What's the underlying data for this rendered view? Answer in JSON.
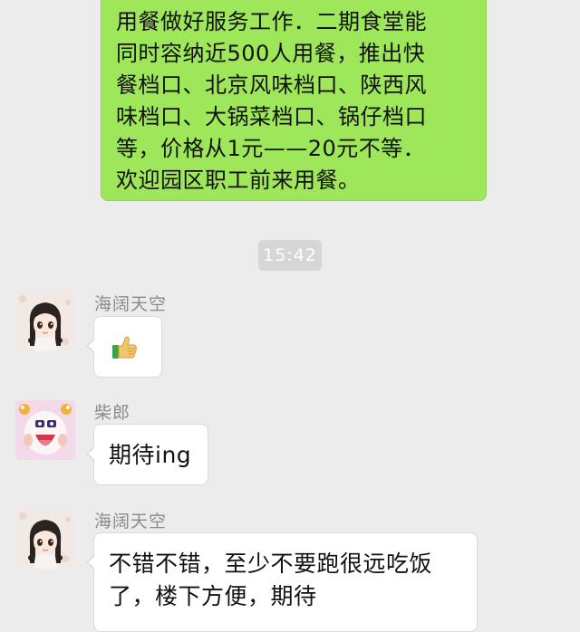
{
  "outgoing_message": {
    "lines": [
      "用餐做好服务工作．二期食堂能",
      "同时容纳近500人用餐，推出快",
      "餐档口、北京风味档口、陕西风",
      "味档口、大锅菜档口、锅仔档口",
      "等，价格从1元——20元不等．",
      "欢迎园区职工前来用餐。"
    ]
  },
  "timestamp": "15:42",
  "messages": [
    {
      "sender": "海阔天空",
      "avatar": "girl-avatar-icon",
      "content_icon": "thumbs-up-emoji-icon"
    },
    {
      "sender": "柴郎",
      "avatar": "cartoon-face-avatar-icon",
      "text": "期待ing"
    },
    {
      "sender": "海阔天空",
      "avatar": "girl-avatar-icon",
      "lines": [
        "不错不错，至少不要跑很远吃饭",
        "了，楼下方便，期待"
      ]
    }
  ],
  "colors": {
    "background": "#ececec",
    "outgoing_bubble": "#9ee65a",
    "incoming_bubble": "#ffffff",
    "timestamp_bg": "#d6d6d6",
    "sender_text": "#8a8a8a"
  }
}
